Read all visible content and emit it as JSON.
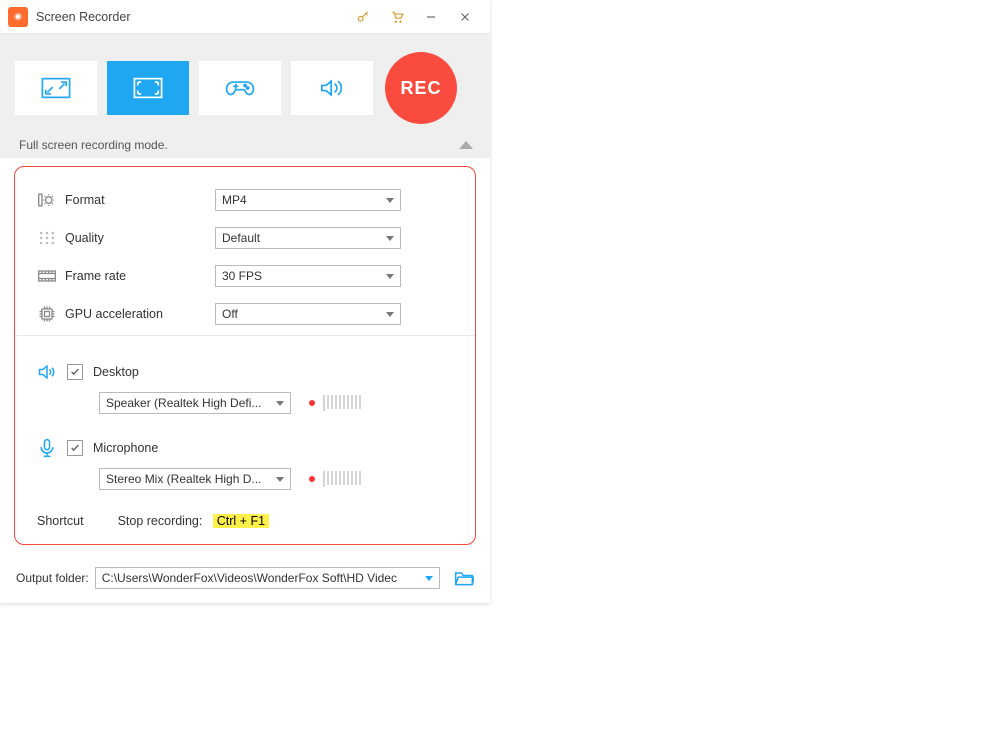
{
  "titlebar": {
    "title": "Screen Recorder"
  },
  "rec_label": "REC",
  "status_text": "Full screen recording mode.",
  "settings": {
    "format": {
      "label": "Format",
      "value": "MP4"
    },
    "quality": {
      "label": "Quality",
      "value": "Default"
    },
    "framerate": {
      "label": "Frame rate",
      "value": "30 FPS"
    },
    "gpu": {
      "label": "GPU acceleration",
      "value": "Off"
    }
  },
  "audio": {
    "desktop": {
      "label": "Desktop",
      "device": "Speaker (Realtek High Defi..."
    },
    "mic": {
      "label": "Microphone",
      "device": "Stereo Mix (Realtek High D..."
    }
  },
  "shortcut": {
    "label": "Shortcut",
    "stop_label": "Stop recording:",
    "hotkey": "Ctrl + F1"
  },
  "output": {
    "label": "Output folder:",
    "path": "C:\\Users\\WonderFox\\Videos\\WonderFox Soft\\HD Videc"
  }
}
